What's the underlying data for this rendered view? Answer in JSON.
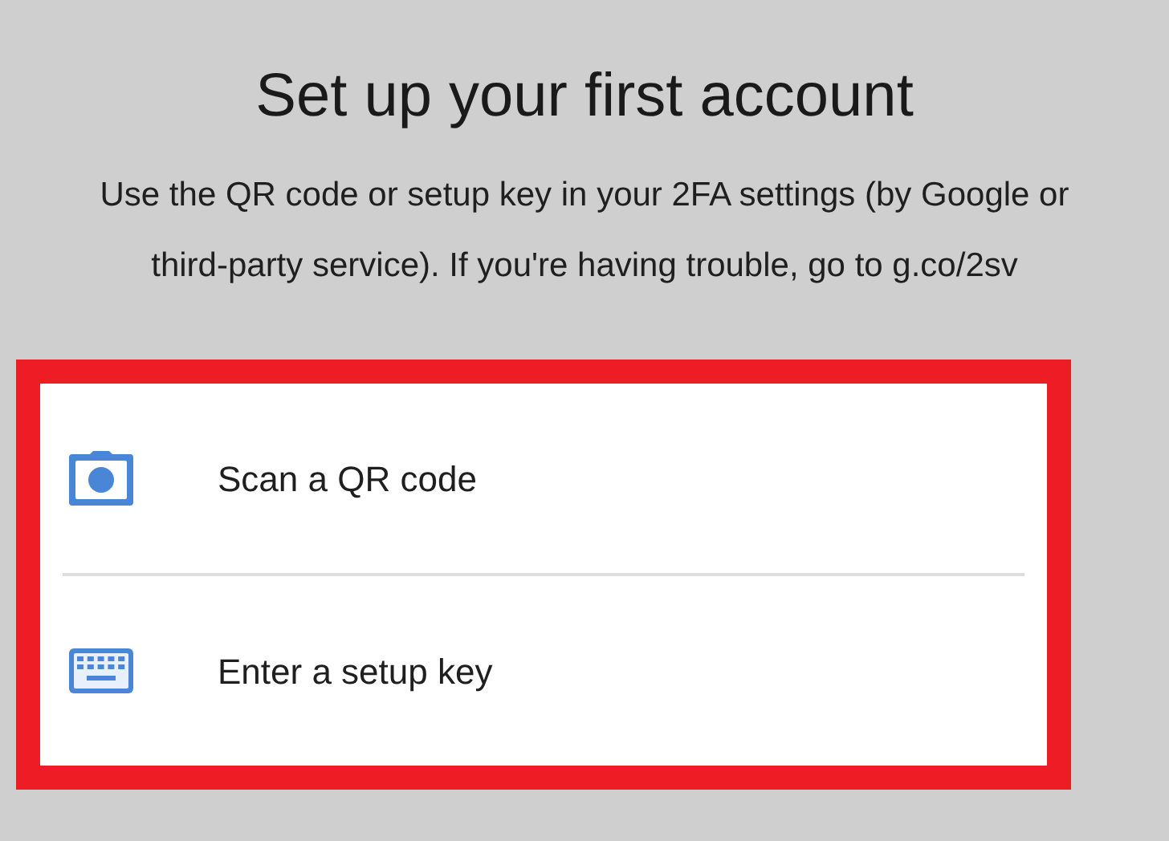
{
  "title": "Set up your first account",
  "description": "Use the QR code or setup key in your 2FA settings (by Google or third-party service). If you're having trouble, go to g.co/2sv",
  "options": [
    {
      "kind": "camera",
      "label": "Scan a QR code"
    },
    {
      "kind": "keyboard",
      "label": "Enter a setup key"
    }
  ]
}
